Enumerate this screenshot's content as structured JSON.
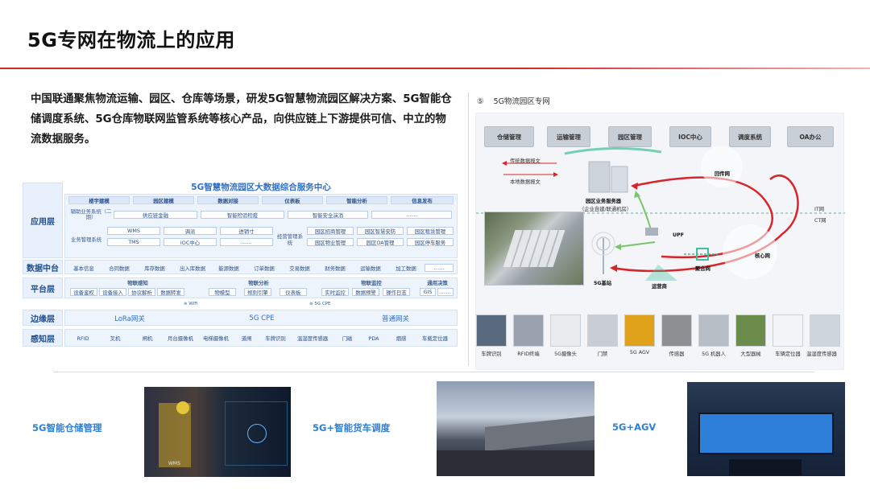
{
  "page": {
    "title": "5G专网在物流上的应用",
    "intro": "中国联通聚焦物流运输、园区、仓库等场景，研发5G智慧物流园区解决方案、5G智能仓储调度系统、5G仓库物联网监管系统等核心产品，向供应链上下游提供可信、中立的物流数据服务。"
  },
  "architecture": {
    "title": "5G智慧物流园区大数据综合服务中心",
    "layers": {
      "application": "应用层",
      "data_platform": "数据中台",
      "platform": "平台层",
      "edge": "边缘层",
      "perception": "感知层"
    },
    "app_top_row": [
      "楼宇建模",
      "园区建模",
      "数据对接",
      "仪表板",
      "智能分析",
      "信息发布"
    ],
    "app_group_1": "辅助业务系统（二期）",
    "app_group_1_items": [
      "供应链金融",
      "智能检验检疫",
      "智能安全演消",
      "……"
    ],
    "app_group_2": "业务管理系统",
    "app_group_2_items": [
      "WMS",
      "调派",
      "进销寸",
      "TMS",
      "IOC中心",
      "……"
    ],
    "app_group_3": "经营管理系统",
    "app_group_3_items": [
      "园区招商管理",
      "园区智慧安防",
      "园区租赁管理",
      "园区物业管理",
      "园区OA管理",
      "园区停车服务"
    ],
    "data_items": [
      "基本信息",
      "合同数据",
      "库存数据",
      "出入库数据",
      "能源数据",
      "订单数据",
      "交易数据",
      "财务数据",
      "运输数据",
      "加工数据",
      "……"
    ],
    "platform_groups": [
      {
        "name": "物联感知",
        "items": [
          "设备鉴权",
          "设备接入",
          "协议解析",
          "数据转发"
        ]
      },
      {
        "name": "物联分析",
        "items": [
          "物模型",
          "规则引擎",
          "仪表板"
        ]
      },
      {
        "name": "物联监控",
        "items": [
          "实时监控",
          "数据预警",
          "操作日志"
        ]
      },
      {
        "name": "通用决策",
        "items": [
          "GIS",
          "……"
        ]
      }
    ],
    "wifi_label_1": "WiFi",
    "wifi_label_2": "5G CPE",
    "edge_items": [
      "LoRa网关",
      "5G CPE",
      "普通网关"
    ],
    "sensor_items": [
      "RFID",
      "叉机",
      "闸机",
      "月台摄像机",
      "电梯摄像机",
      "道闸",
      "车牌识别",
      "温湿度传感器",
      "门磁",
      "PDA",
      "烟感",
      "车载定位器"
    ]
  },
  "network": {
    "title": "5G物流园区专网",
    "title_icon": "⑤",
    "systems": [
      "仓储管理",
      "运输管理",
      "园区管理",
      "IOC中心",
      "调度系统",
      "OA办公"
    ],
    "labels": {
      "upstream": "传统数据报文",
      "local": "本地数据报文",
      "server": "园区业务服务器",
      "server_sub": "（企业自建/联通机房）",
      "backhaul": "回传网",
      "it": "IT网",
      "ct": "CT网",
      "upf": "UPF",
      "base_station": "5G基站",
      "operator": "运营商",
      "aggregation": "聚合网",
      "core": "核心网"
    },
    "devices": [
      "车牌识别",
      "RFID终端",
      "5G摄像头",
      "门禁",
      "5G AGV",
      "传感器",
      "5G 机器人",
      "大型器械",
      "车辆定位器",
      "温湿度传感器"
    ],
    "device_colors": [
      "#5a6a7e",
      "#9aa3ad",
      "#e9ecef",
      "#c9ced4",
      "#e0a11b",
      "#8d8f93",
      "#b8bec6",
      "#6b8c4a",
      "#f2f4f6",
      "#cfd5dc"
    ]
  },
  "scenarios": [
    {
      "caption": "5G智能仓储管理",
      "overlay": "WMS"
    },
    {
      "caption": "5G+智能货车调度"
    },
    {
      "caption": "5G+AGV"
    }
  ]
}
